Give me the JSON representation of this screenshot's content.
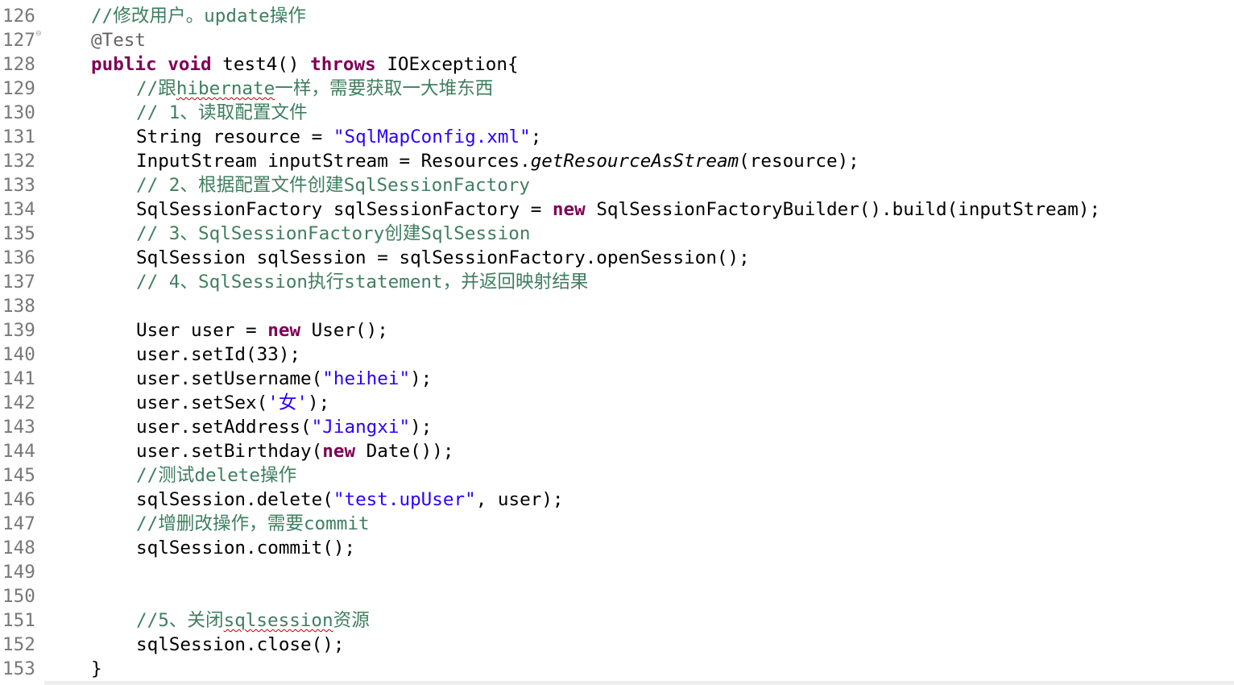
{
  "editor": {
    "fold_icon": "fold-collapse-icon",
    "colors": {
      "comment": "#3f7f5f",
      "keyword": "#7f0055",
      "string": "#2a00ff",
      "annotation": "#646464",
      "line_number": "#787878",
      "spellcheck_underline": "#c00000"
    },
    "lines": [
      {
        "num": "126",
        "indent": 1,
        "tokens": [
          {
            "t": "comment",
            "v": "//修改用户。update操作"
          }
        ]
      },
      {
        "num": "127",
        "indent": 1,
        "fold": true,
        "tokens": [
          {
            "t": "annotation",
            "v": "@Test"
          }
        ]
      },
      {
        "num": "128",
        "indent": 1,
        "tokens": [
          {
            "t": "keyword",
            "v": "public"
          },
          {
            "t": "plain",
            "v": " "
          },
          {
            "t": "keyword",
            "v": "void"
          },
          {
            "t": "plain",
            "v": " test4() "
          },
          {
            "t": "keyword",
            "v": "throws"
          },
          {
            "t": "plain",
            "v": " IOException{"
          }
        ]
      },
      {
        "num": "129",
        "indent": 2,
        "tokens": [
          {
            "t": "comment",
            "v": "//跟"
          },
          {
            "t": "comment",
            "v": "hibernate",
            "squiggle": true
          },
          {
            "t": "comment",
            "v": "一样，需要获取一大堆东西"
          }
        ]
      },
      {
        "num": "130",
        "indent": 2,
        "tokens": [
          {
            "t": "comment",
            "v": "// 1、读取配置文件"
          }
        ]
      },
      {
        "num": "131",
        "indent": 2,
        "tokens": [
          {
            "t": "plain",
            "v": "String resource = "
          },
          {
            "t": "string",
            "v": "\"SqlMapConfig.xml\""
          },
          {
            "t": "plain",
            "v": ";"
          }
        ]
      },
      {
        "num": "132",
        "indent": 2,
        "tokens": [
          {
            "t": "plain",
            "v": "InputStream inputStream = Resources."
          },
          {
            "t": "italic",
            "v": "getResourceAsStream"
          },
          {
            "t": "plain",
            "v": "(resource);"
          }
        ]
      },
      {
        "num": "133",
        "indent": 2,
        "tokens": [
          {
            "t": "comment",
            "v": "// 2、根据配置文件创建SqlSessionFactory"
          }
        ]
      },
      {
        "num": "134",
        "indent": 2,
        "tokens": [
          {
            "t": "plain",
            "v": "SqlSessionFactory sqlSessionFactory = "
          },
          {
            "t": "keyword",
            "v": "new"
          },
          {
            "t": "plain",
            "v": " SqlSessionFactoryBuilder().build(inputStream);"
          }
        ]
      },
      {
        "num": "135",
        "indent": 2,
        "tokens": [
          {
            "t": "comment",
            "v": "// 3、SqlSessionFactory创建SqlSession"
          }
        ]
      },
      {
        "num": "136",
        "indent": 2,
        "tokens": [
          {
            "t": "plain",
            "v": "SqlSession sqlSession = sqlSessionFactory.openSession();"
          }
        ]
      },
      {
        "num": "137",
        "indent": 2,
        "tokens": [
          {
            "t": "comment",
            "v": "// 4、SqlSession执行statement，并返回映射结果"
          }
        ]
      },
      {
        "num": "138",
        "indent": 2,
        "tokens": []
      },
      {
        "num": "139",
        "indent": 2,
        "tokens": [
          {
            "t": "plain",
            "v": "User user = "
          },
          {
            "t": "keyword",
            "v": "new"
          },
          {
            "t": "plain",
            "v": " User();"
          }
        ]
      },
      {
        "num": "140",
        "indent": 2,
        "tokens": [
          {
            "t": "plain",
            "v": "user.setId(33);"
          }
        ]
      },
      {
        "num": "141",
        "indent": 2,
        "tokens": [
          {
            "t": "plain",
            "v": "user.setUsername("
          },
          {
            "t": "string",
            "v": "\"heihei\""
          },
          {
            "t": "plain",
            "v": ");"
          }
        ]
      },
      {
        "num": "142",
        "indent": 2,
        "tokens": [
          {
            "t": "plain",
            "v": "user.setSex("
          },
          {
            "t": "string",
            "v": "'女'"
          },
          {
            "t": "plain",
            "v": ");"
          }
        ]
      },
      {
        "num": "143",
        "indent": 2,
        "tokens": [
          {
            "t": "plain",
            "v": "user.setAddress("
          },
          {
            "t": "string",
            "v": "\"Jiangxi\""
          },
          {
            "t": "plain",
            "v": ");"
          }
        ]
      },
      {
        "num": "144",
        "indent": 2,
        "tokens": [
          {
            "t": "plain",
            "v": "user.setBirthday("
          },
          {
            "t": "keyword",
            "v": "new"
          },
          {
            "t": "plain",
            "v": " Date());"
          }
        ]
      },
      {
        "num": "145",
        "indent": 2,
        "tokens": [
          {
            "t": "comment",
            "v": "//测试delete操作"
          }
        ]
      },
      {
        "num": "146",
        "indent": 2,
        "tokens": [
          {
            "t": "plain",
            "v": "sqlSession.delete("
          },
          {
            "t": "string",
            "v": "\"test.upUser\""
          },
          {
            "t": "plain",
            "v": ", user);"
          }
        ]
      },
      {
        "num": "147",
        "indent": 2,
        "tokens": [
          {
            "t": "comment",
            "v": "//增删改操作，需要commit"
          }
        ]
      },
      {
        "num": "148",
        "indent": 2,
        "tokens": [
          {
            "t": "plain",
            "v": "sqlSession.commit();"
          }
        ]
      },
      {
        "num": "149",
        "indent": 2,
        "tokens": []
      },
      {
        "num": "150",
        "indent": 2,
        "tokens": []
      },
      {
        "num": "151",
        "indent": 2,
        "tokens": [
          {
            "t": "comment",
            "v": "//5、关闭"
          },
          {
            "t": "comment",
            "v": "sqlsession",
            "squiggle": true
          },
          {
            "t": "comment",
            "v": "资源"
          }
        ]
      },
      {
        "num": "152",
        "indent": 2,
        "tokens": [
          {
            "t": "plain",
            "v": "sqlSession.close();"
          }
        ]
      },
      {
        "num": "153",
        "indent": 1,
        "tokens": [
          {
            "t": "plain",
            "v": "}"
          }
        ]
      }
    ]
  }
}
